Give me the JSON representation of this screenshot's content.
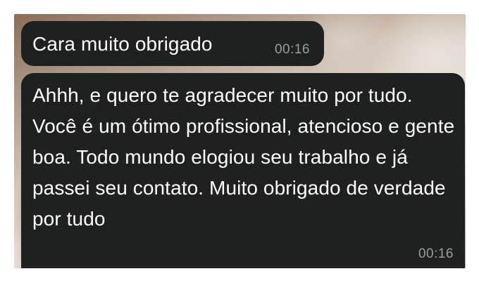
{
  "chat": {
    "messages": [
      {
        "text": "Cara muito obrigado",
        "time": "00:16"
      },
      {
        "text": "Ahhh, e quero te agradecer muito por tudo. Você é um ótimo profissional, atencioso e gente boa. Todo mundo elogiou seu trabalho e já passei seu contato. Muito obrigado de verdade por tudo",
        "time": "00:16"
      }
    ]
  },
  "colors": {
    "bubble_background": "#1f2121",
    "message_text": "#ffffff",
    "timestamp_text": "#9a9c9c"
  }
}
